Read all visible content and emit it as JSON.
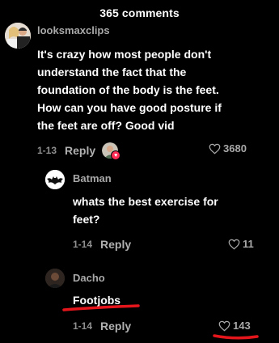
{
  "header": {
    "title": "365 comments"
  },
  "comments": [
    {
      "username": "looksmaxclips",
      "text": "It's crazy how most people don't understand the fact that the foundation of the body is the feet. How can you have good posture if the feet are off? Good vid",
      "date": "1-13",
      "reply_label": "Reply",
      "likes": "3680"
    },
    {
      "username": "Batman",
      "text": "whats the best exercise for feet?",
      "date": "1-14",
      "reply_label": "Reply",
      "likes": "11"
    },
    {
      "username": "Dacho",
      "text": "Footjobs",
      "date": "1-14",
      "reply_label": "Reply",
      "likes": "143"
    }
  ],
  "colors": {
    "background": "#000000",
    "text": "#ffffff",
    "secondary": "#a8a8a8",
    "annotation_red": "#e4161c",
    "liked_badge": "#fe2c55"
  },
  "icons": {
    "like": "heart-outline-icon",
    "creator_liked": "creator-liked-avatar-icon"
  }
}
